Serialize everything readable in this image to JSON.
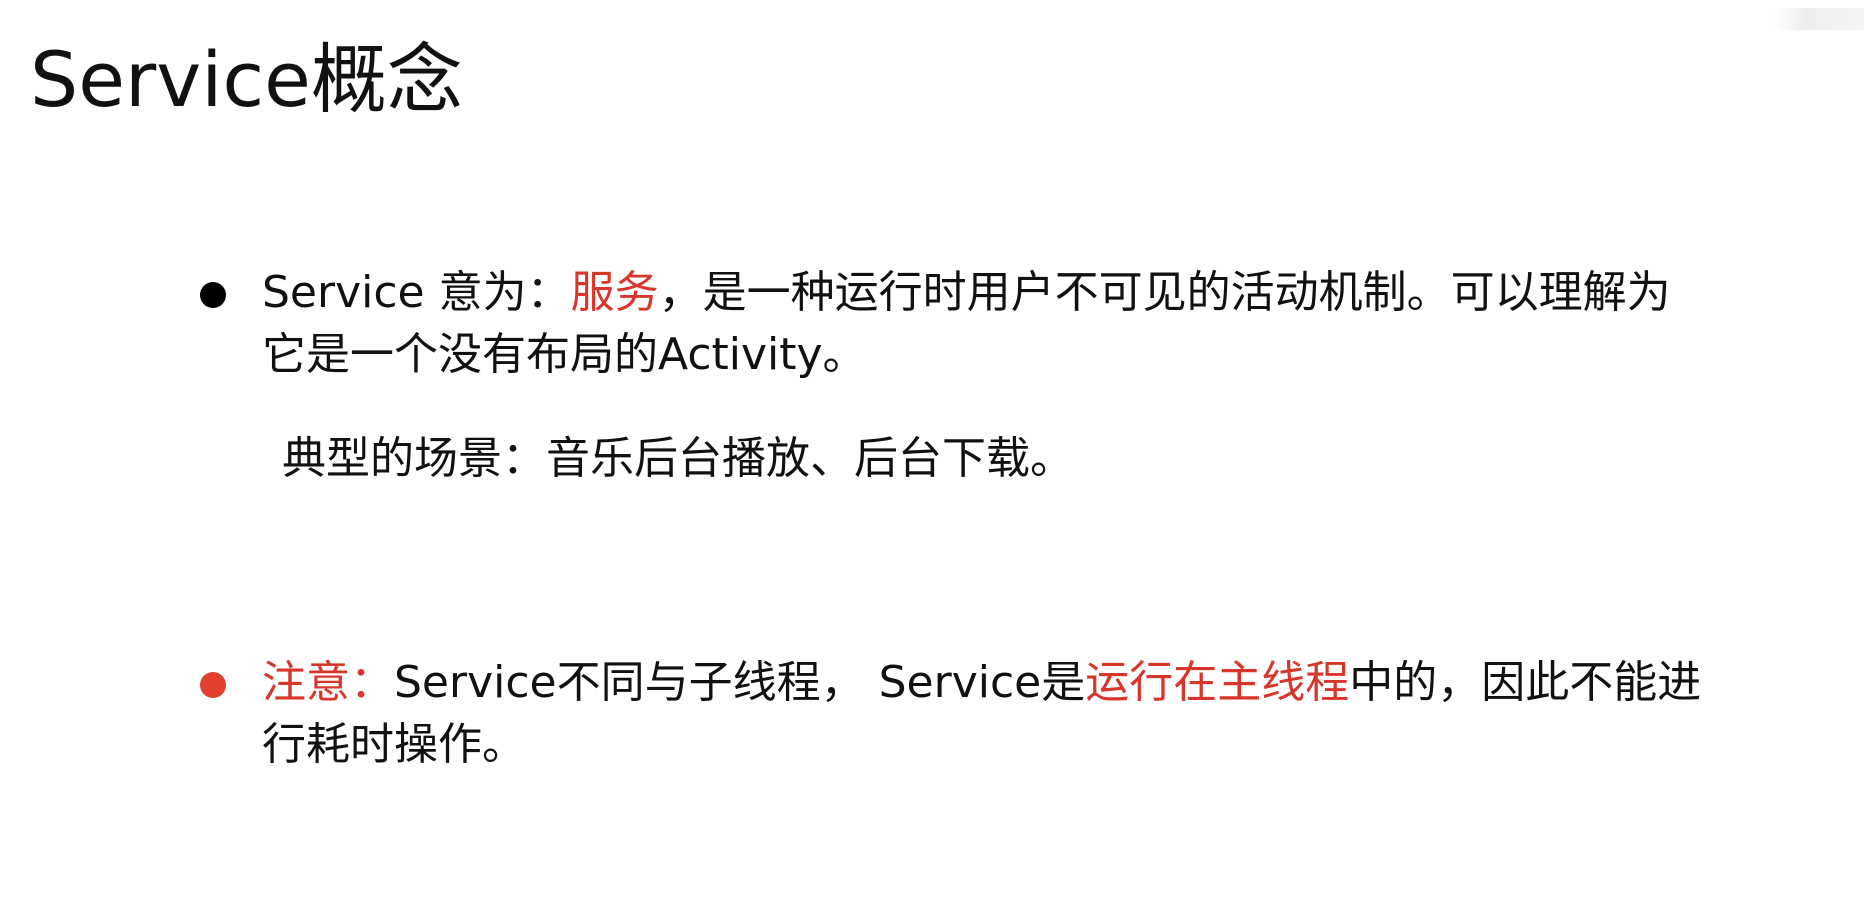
{
  "slide": {
    "title": "Service概念",
    "bullet1": {
      "lead": "Service 意为：",
      "highlight": "服务",
      "rest_line1": "，是一种运行时用户不可见的活动机制。可以理解为",
      "line2": "它是一个没有布局的Activity。",
      "dot_color": "#000000"
    },
    "scenario": "典型的场景：音乐后台播放、后台下载。",
    "bullet2": {
      "label": "注意：",
      "part1": "Service不同与子线程， Service是",
      "highlight": "运行在主线程",
      "part2": "中的，因此不能进",
      "line2": "行耗时操作。",
      "dot_color": "#e2402e"
    },
    "colors": {
      "accent_red": "#d9362b",
      "text": "#111111",
      "background": "#ffffff"
    }
  }
}
